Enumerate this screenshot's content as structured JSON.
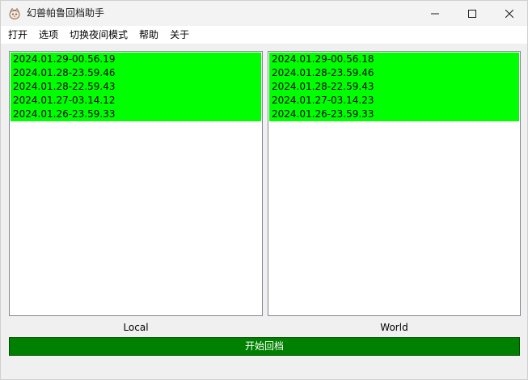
{
  "window": {
    "title": "幻兽帕鲁回档助手"
  },
  "menu": {
    "items": [
      "打开",
      "选项",
      "切换夜间模式",
      "帮助",
      "关于"
    ]
  },
  "lists": {
    "local": {
      "label": "Local",
      "items": [
        "2024.01.29-00.56.19",
        "2024.01.28-23.59.46",
        "2024.01.28-22.59.43",
        "2024.01.27-03.14.12",
        "2024.01.26-23.59.33"
      ]
    },
    "world": {
      "label": "World",
      "items": [
        "2024.01.29-00.56.18",
        "2024.01.28-23.59.46",
        "2024.01.28-22.59.43",
        "2024.01.27-03.14.23",
        "2024.01.26-23.59.33"
      ]
    }
  },
  "actions": {
    "start_label": "开始回档"
  },
  "colors": {
    "selected_row": "#00ff00",
    "start_button": "#008000"
  }
}
